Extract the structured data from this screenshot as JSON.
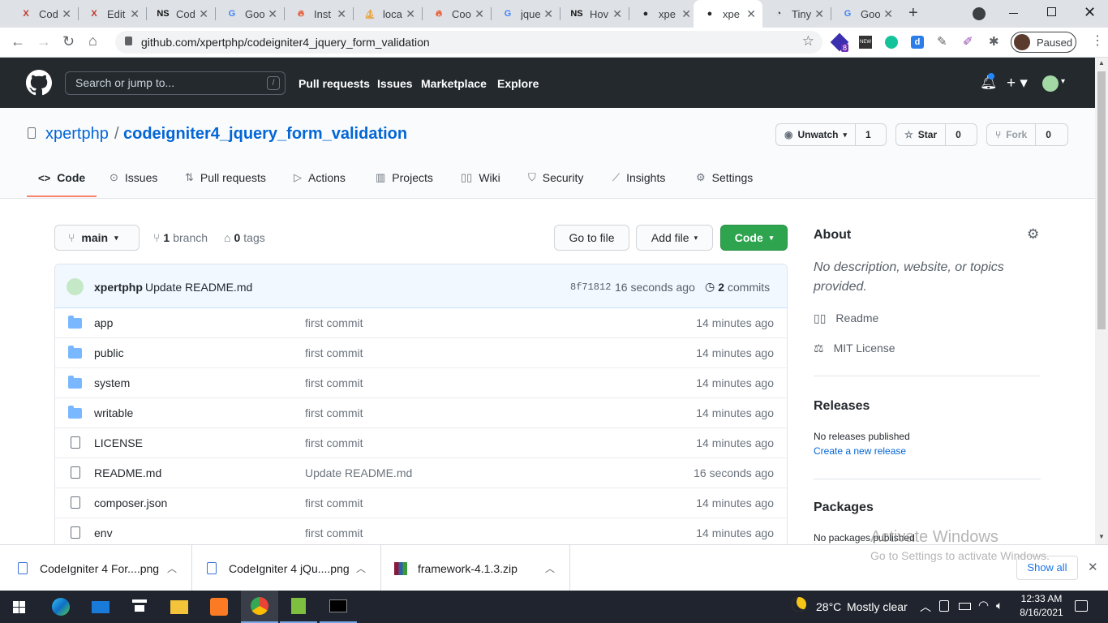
{
  "browser": {
    "tabs": [
      {
        "title": "Cod",
        "favicon": "X",
        "color": "#c0392b"
      },
      {
        "title": "Edit",
        "favicon": "X",
        "color": "#c0392b"
      },
      {
        "title": "Cod",
        "favicon": "NS",
        "color": "#111111"
      },
      {
        "title": "Goo",
        "favicon": "G",
        "color": "#4285f4"
      },
      {
        "title": "Inst",
        "favicon": "flame",
        "color": "#e8542a"
      },
      {
        "title": "loca",
        "favicon": "pma",
        "color": "#e7a13a"
      },
      {
        "title": "Coo",
        "favicon": "flame",
        "color": "#e8542a"
      },
      {
        "title": "jque",
        "favicon": "G",
        "color": "#4285f4"
      },
      {
        "title": "Hov",
        "favicon": "NS",
        "color": "#111111"
      },
      {
        "title": "xpe",
        "favicon": "github",
        "color": "#24292e"
      },
      {
        "title": "xpe",
        "favicon": "github",
        "color": "#24292e"
      },
      {
        "title": "Tiny",
        "favicon": "panda",
        "color": "#333333"
      },
      {
        "title": "Goo",
        "favicon": "G",
        "color": "#4285f4"
      }
    ],
    "active_tab_index": 10,
    "url": "github.com/xpertphp/codeigniter4_jquery_form_validation",
    "profile_status": "Paused",
    "extension_badge": "8"
  },
  "github": {
    "search_placeholder": "Search or jump to...",
    "slash_hint": "/",
    "nav": [
      "Pull requests",
      "Issues",
      "Marketplace",
      "Explore"
    ],
    "owner": "xpertphp",
    "separator": "/",
    "repo": "codeigniter4_jquery_form_validation",
    "watch": {
      "label": "Unwatch",
      "count": "1"
    },
    "star": {
      "label": "Star",
      "count": "0"
    },
    "fork": {
      "label": "Fork",
      "count": "0"
    },
    "tabs": [
      "Code",
      "Issues",
      "Pull requests",
      "Actions",
      "Projects",
      "Wiki",
      "Security",
      "Insights",
      "Settings"
    ],
    "branch": "main",
    "branch_count": "1",
    "branch_label": "branch",
    "tag_count": "0",
    "tag_label": "tags",
    "go_to_file": "Go to file",
    "add_file": "Add file",
    "code_button": "Code",
    "commit": {
      "author": "xpertphp",
      "message": "Update README.md",
      "hash": "8f71812",
      "time": "16 seconds ago",
      "count": "2",
      "count_label": "commits"
    },
    "files": [
      {
        "name": "app",
        "type": "folder",
        "message": "first commit",
        "age": "14 minutes ago"
      },
      {
        "name": "public",
        "type": "folder",
        "message": "first commit",
        "age": "14 minutes ago"
      },
      {
        "name": "system",
        "type": "folder",
        "message": "first commit",
        "age": "14 minutes ago"
      },
      {
        "name": "writable",
        "type": "folder",
        "message": "first commit",
        "age": "14 minutes ago"
      },
      {
        "name": "LICENSE",
        "type": "file",
        "message": "first commit",
        "age": "14 minutes ago"
      },
      {
        "name": "README.md",
        "type": "file",
        "message": "Update README.md",
        "age": "16 seconds ago"
      },
      {
        "name": "composer.json",
        "type": "file",
        "message": "first commit",
        "age": "14 minutes ago"
      },
      {
        "name": "env",
        "type": "file",
        "message": "first commit",
        "age": "14 minutes ago"
      }
    ],
    "about": {
      "title": "About",
      "description": "No description, website, or topics provided.",
      "readme": "Readme",
      "license": "MIT License"
    },
    "releases": {
      "title": "Releases",
      "none": "No releases published",
      "create": "Create a new release"
    },
    "packages": {
      "title": "Packages",
      "none": "No packages published"
    }
  },
  "watermark": {
    "line1": "Activate Windows",
    "line2": "Go to Settings to activate Windows."
  },
  "downloads": {
    "items": [
      "CodeIgniter 4 For....png",
      "CodeIgniter 4 jQu....png",
      "framework-4.1.3.zip"
    ],
    "show_all": "Show all"
  },
  "taskbar": {
    "temperature": "28°C",
    "weather": "Mostly clear",
    "time": "12:33 AM",
    "date": "8/16/2021"
  },
  "colors": {
    "github_header": "#24292e",
    "accent_green": "#2ea44f",
    "link_blue": "#0366d6",
    "tab_underline": "#f9826c"
  }
}
